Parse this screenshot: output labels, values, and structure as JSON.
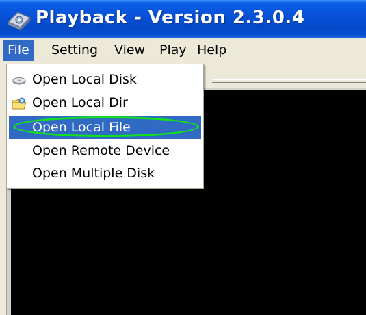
{
  "window": {
    "title": "Playback - Version 2.3.0.4",
    "title_icon": "app-icon"
  },
  "menubar": {
    "items": [
      {
        "label": "File",
        "active": true
      },
      {
        "label": "Setting"
      },
      {
        "label": "View"
      },
      {
        "label": "Play"
      },
      {
        "label": "Help"
      }
    ]
  },
  "file_menu": {
    "items": [
      {
        "label": "Open Local Disk",
        "icon": "disk-icon"
      },
      {
        "label": "Open Local Dir",
        "icon": "folder-icon"
      },
      {
        "label": "Open Local File",
        "highlighted": true
      },
      {
        "label": "Open Remote Device"
      },
      {
        "label": "Open Multiple Disk"
      }
    ]
  },
  "colors": {
    "titlebar": "#0752d8",
    "menu_highlight": "#316ac5",
    "annotation_ring": "#12e01a",
    "video_background": "#000000"
  }
}
